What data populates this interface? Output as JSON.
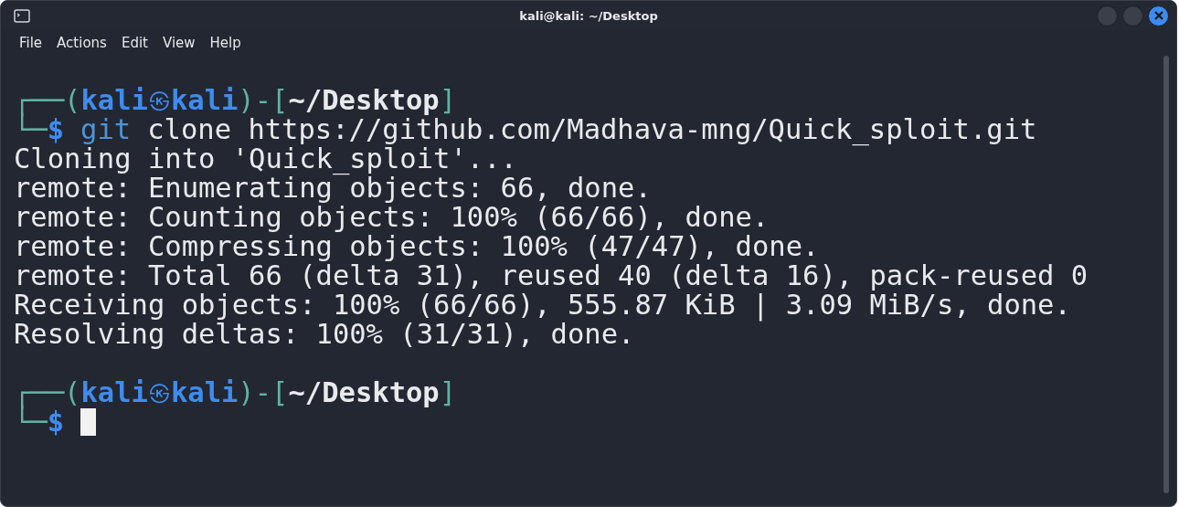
{
  "window": {
    "title": "kali@kali: ~/Desktop"
  },
  "menu": [
    "File",
    "Actions",
    "Edit",
    "View",
    "Help"
  ],
  "lines": [
    {
      "kind": "prompt",
      "open": "┌──(",
      "user": "kali",
      "at": "㉿",
      "host": "kali",
      "mid": ")-[",
      "path": "~/Desktop",
      "close": "]"
    },
    {
      "kind": "command",
      "corner": "└─",
      "symbol": "$",
      "program": "git",
      "args": "clone https://github.com/Madhava-mng/Quick_sploit.git"
    },
    {
      "kind": "output",
      "text": "Cloning into 'Quick_sploit'..."
    },
    {
      "kind": "output",
      "text": "remote: Enumerating objects: 66, done."
    },
    {
      "kind": "output",
      "text": "remote: Counting objects: 100% (66/66), done."
    },
    {
      "kind": "output",
      "text": "remote: Compressing objects: 100% (47/47), done."
    },
    {
      "kind": "output",
      "text": "remote: Total 66 (delta 31), reused 40 (delta 16), pack-reused 0"
    },
    {
      "kind": "output",
      "text": "Receiving objects: 100% (66/66), 555.87 KiB | 3.09 MiB/s, done."
    },
    {
      "kind": "output",
      "text": "Resolving deltas: 100% (31/31), done."
    },
    {
      "kind": "prompt",
      "open": "┌──(",
      "user": "kali",
      "at": "㉿",
      "host": "kali",
      "mid": ")-[",
      "path": "~/Desktop",
      "close": "]"
    },
    {
      "kind": "command",
      "corner": "└─",
      "symbol": "$",
      "cursor": true
    }
  ]
}
